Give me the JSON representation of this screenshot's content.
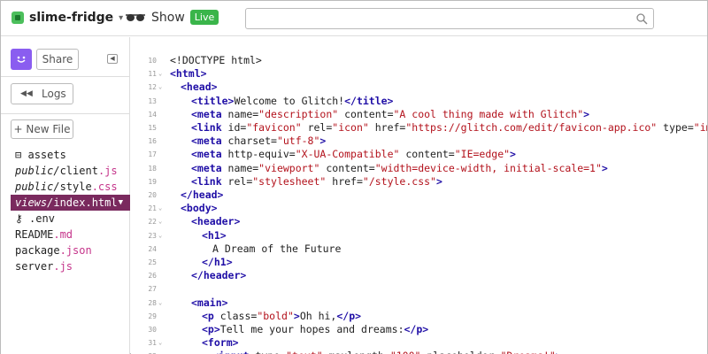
{
  "header": {
    "project_name": "slime-fridge",
    "show_label": "Show",
    "live_badge": "Live",
    "search_placeholder": ""
  },
  "sidebar": {
    "share_label": "Share",
    "logs_label": "Logs",
    "new_file_label": "+ New File",
    "files": [
      {
        "prefix": "",
        "italic_prefix": "",
        "name": "assets",
        "ext": "",
        "icon": "box-icon"
      },
      {
        "prefix": "",
        "italic_prefix": "public/",
        "name": "client",
        "ext": ".js"
      },
      {
        "prefix": "",
        "italic_prefix": "public/",
        "name": "style",
        "ext": ".css"
      },
      {
        "prefix": "",
        "italic_prefix": "views/",
        "name": "index",
        "ext": ".html",
        "active": true
      },
      {
        "prefix": "",
        "italic_prefix": "",
        "name": ".env",
        "ext": "",
        "icon": "key-icon"
      },
      {
        "prefix": "",
        "italic_prefix": "",
        "name": "README",
        "ext": ".md"
      },
      {
        "prefix": "",
        "italic_prefix": "",
        "name": "package",
        "ext": ".json"
      },
      {
        "prefix": "",
        "italic_prefix": "",
        "name": "server",
        "ext": ".js"
      }
    ]
  },
  "editor": {
    "lines": [
      {
        "n": "10",
        "fold": "",
        "indent": 0,
        "tokens": [
          [
            "p",
            "<!DOCTYPE html>"
          ]
        ]
      },
      {
        "n": "11",
        "fold": "v",
        "indent": 0,
        "tokens": [
          [
            "t",
            "<html>"
          ]
        ]
      },
      {
        "n": "12",
        "fold": "v",
        "indent": 1,
        "tokens": [
          [
            "t",
            "<head>"
          ]
        ]
      },
      {
        "n": "13",
        "fold": "",
        "indent": 2,
        "tokens": [
          [
            "t",
            "<title>"
          ],
          [
            "p",
            "Welcome to Glitch!"
          ],
          [
            "t",
            "</title>"
          ]
        ]
      },
      {
        "n": "14",
        "fold": "",
        "indent": 2,
        "tokens": [
          [
            "t",
            "<meta"
          ],
          [
            "a",
            " name="
          ],
          [
            "s",
            "\"description\""
          ],
          [
            "a",
            " content="
          ],
          [
            "s",
            "\"A cool thing made with Glitch\""
          ],
          [
            "t",
            ">"
          ]
        ]
      },
      {
        "n": "15",
        "fold": "",
        "indent": 2,
        "tokens": [
          [
            "t",
            "<link"
          ],
          [
            "a",
            " id="
          ],
          [
            "s",
            "\"favicon\""
          ],
          [
            "a",
            " rel="
          ],
          [
            "s",
            "\"icon\""
          ],
          [
            "a",
            " href="
          ],
          [
            "s",
            "\"https://glitch.com/edit/favicon-app.ico\""
          ],
          [
            "a",
            " type="
          ],
          [
            "s",
            "\"image/x-icon\""
          ],
          [
            "t",
            ">"
          ]
        ]
      },
      {
        "n": "16",
        "fold": "",
        "indent": 2,
        "tokens": [
          [
            "t",
            "<meta"
          ],
          [
            "a",
            " charset="
          ],
          [
            "s",
            "\"utf-8\""
          ],
          [
            "t",
            ">"
          ]
        ]
      },
      {
        "n": "17",
        "fold": "",
        "indent": 2,
        "tokens": [
          [
            "t",
            "<meta"
          ],
          [
            "a",
            " http-equiv="
          ],
          [
            "s",
            "\"X-UA-Compatible\""
          ],
          [
            "a",
            " content="
          ],
          [
            "s",
            "\"IE=edge\""
          ],
          [
            "t",
            ">"
          ]
        ]
      },
      {
        "n": "18",
        "fold": "",
        "indent": 2,
        "tokens": [
          [
            "t",
            "<meta"
          ],
          [
            "a",
            " name="
          ],
          [
            "s",
            "\"viewport\""
          ],
          [
            "a",
            " content="
          ],
          [
            "s",
            "\"width=device-width, initial-scale=1\""
          ],
          [
            "t",
            ">"
          ]
        ]
      },
      {
        "n": "19",
        "fold": "",
        "indent": 2,
        "tokens": [
          [
            "t",
            "<link"
          ],
          [
            "a",
            " rel="
          ],
          [
            "s",
            "\"stylesheet\""
          ],
          [
            "a",
            " href="
          ],
          [
            "s",
            "\"/style.css\""
          ],
          [
            "t",
            ">"
          ]
        ]
      },
      {
        "n": "20",
        "fold": "",
        "indent": 1,
        "tokens": [
          [
            "t",
            "</head>"
          ]
        ]
      },
      {
        "n": "21",
        "fold": "v",
        "indent": 1,
        "tokens": [
          [
            "t",
            "<body>"
          ]
        ]
      },
      {
        "n": "22",
        "fold": "v",
        "indent": 2,
        "tokens": [
          [
            "t",
            "<header>"
          ]
        ]
      },
      {
        "n": "23",
        "fold": "v",
        "indent": 3,
        "tokens": [
          [
            "t",
            "<h1>"
          ]
        ]
      },
      {
        "n": "24",
        "fold": "",
        "indent": 4,
        "tokens": [
          [
            "p",
            "A Dream of the Future"
          ]
        ]
      },
      {
        "n": "25",
        "fold": "",
        "indent": 3,
        "tokens": [
          [
            "t",
            "</h1>"
          ]
        ]
      },
      {
        "n": "26",
        "fold": "",
        "indent": 2,
        "tokens": [
          [
            "t",
            "</header>"
          ]
        ]
      },
      {
        "n": "27",
        "fold": "",
        "indent": 0,
        "tokens": []
      },
      {
        "n": "28",
        "fold": "v",
        "indent": 2,
        "tokens": [
          [
            "t",
            "<main>"
          ]
        ]
      },
      {
        "n": "29",
        "fold": "",
        "indent": 3,
        "tokens": [
          [
            "t",
            "<p"
          ],
          [
            "a",
            " class="
          ],
          [
            "s",
            "\"bold\""
          ],
          [
            "t",
            ">"
          ],
          [
            "p",
            "Oh hi,"
          ],
          [
            "t",
            "</p>"
          ]
        ]
      },
      {
        "n": "30",
        "fold": "",
        "indent": 3,
        "tokens": [
          [
            "t",
            "<p>"
          ],
          [
            "p",
            "Tell me your hopes and dreams:"
          ],
          [
            "t",
            "</p>"
          ]
        ]
      },
      {
        "n": "31",
        "fold": "v",
        "indent": 3,
        "tokens": [
          [
            "t",
            "<form>"
          ]
        ]
      },
      {
        "n": "32",
        "fold": "",
        "indent": 4,
        "tokens": [
          [
            "t",
            "<input"
          ],
          [
            "a",
            " type="
          ],
          [
            "s",
            "\"text\""
          ],
          [
            "a",
            " maxlength="
          ],
          [
            "s",
            "\"100\""
          ],
          [
            "a",
            " placeholder="
          ],
          [
            "s",
            "\"Dreams!\""
          ],
          [
            "t",
            ">"
          ]
        ]
      }
    ]
  }
}
